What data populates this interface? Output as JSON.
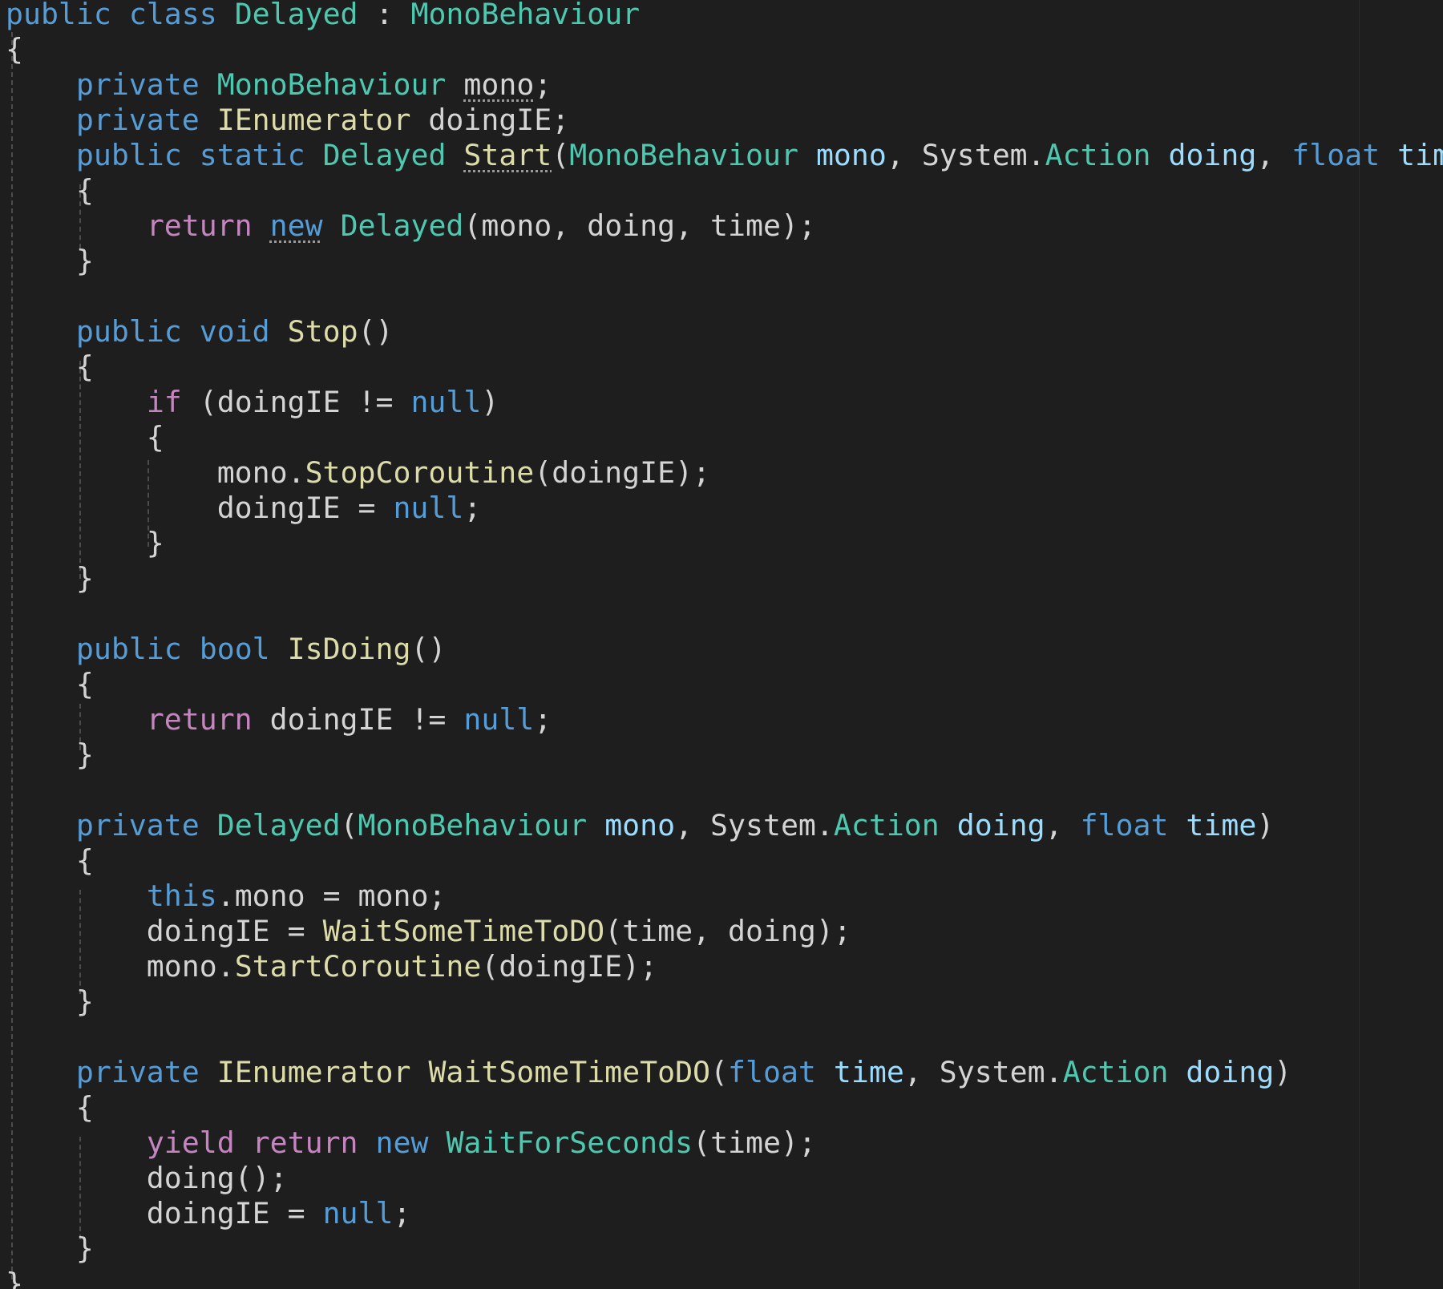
{
  "editor": {
    "theme_background": "#1e1e1e",
    "colors": {
      "keyword": "#569cd6",
      "control_keyword": "#c586c0",
      "type": "#4ec9b0",
      "function": "#dcdcaa",
      "parameter": "#9cdcfe",
      "text": "#d4d4d4"
    },
    "lines": [
      [
        {
          "t": "public",
          "c": "k-blue"
        },
        {
          "t": " ",
          "c": "k-plain"
        },
        {
          "t": "class",
          "c": "k-blue"
        },
        {
          "t": " ",
          "c": "k-plain"
        },
        {
          "t": "Delayed",
          "c": "k-type"
        },
        {
          "t": " : ",
          "c": "k-plain"
        },
        {
          "t": "MonoBehaviour",
          "c": "k-type"
        }
      ],
      [
        {
          "t": "{",
          "c": "k-plain"
        }
      ],
      [
        {
          "t": "    ",
          "c": "k-plain"
        },
        {
          "t": "private",
          "c": "k-blue"
        },
        {
          "t": " ",
          "c": "k-plain"
        },
        {
          "t": "MonoBehaviour",
          "c": "k-type"
        },
        {
          "t": " ",
          "c": "k-plain"
        },
        {
          "t": "mono",
          "c": "k-plain",
          "u": true
        },
        {
          "t": ";",
          "c": "k-plain"
        }
      ],
      [
        {
          "t": "    ",
          "c": "k-plain"
        },
        {
          "t": "private",
          "c": "k-blue"
        },
        {
          "t": " ",
          "c": "k-plain"
        },
        {
          "t": "IEnumerator",
          "c": "k-fn"
        },
        {
          "t": " doingIE;",
          "c": "k-plain"
        }
      ],
      [
        {
          "t": "    ",
          "c": "k-plain"
        },
        {
          "t": "public",
          "c": "k-blue"
        },
        {
          "t": " ",
          "c": "k-plain"
        },
        {
          "t": "static",
          "c": "k-blue"
        },
        {
          "t": " ",
          "c": "k-plain"
        },
        {
          "t": "Delayed",
          "c": "k-type"
        },
        {
          "t": " ",
          "c": "k-plain"
        },
        {
          "t": "Start",
          "c": "k-fn",
          "u": true
        },
        {
          "t": "(",
          "c": "k-plain"
        },
        {
          "t": "MonoBehaviour",
          "c": "k-type"
        },
        {
          "t": " ",
          "c": "k-plain"
        },
        {
          "t": "mono",
          "c": "k-param"
        },
        {
          "t": ", System.",
          "c": "k-plain"
        },
        {
          "t": "Action",
          "c": "k-type"
        },
        {
          "t": " ",
          "c": "k-plain"
        },
        {
          "t": "doing",
          "c": "k-param"
        },
        {
          "t": ", ",
          "c": "k-plain"
        },
        {
          "t": "float",
          "c": "k-blue"
        },
        {
          "t": " ",
          "c": "k-plain"
        },
        {
          "t": "time",
          "c": "k-param"
        },
        {
          "t": ")",
          "c": "k-plain"
        }
      ],
      [
        {
          "t": "    {",
          "c": "k-plain"
        }
      ],
      [
        {
          "t": "        ",
          "c": "k-plain"
        },
        {
          "t": "return",
          "c": "k-purple"
        },
        {
          "t": " ",
          "c": "k-plain"
        },
        {
          "t": "new",
          "c": "k-blue",
          "u": true
        },
        {
          "t": " ",
          "c": "k-plain"
        },
        {
          "t": "Delayed",
          "c": "k-type"
        },
        {
          "t": "(mono, doing, time);",
          "c": "k-plain"
        }
      ],
      [
        {
          "t": "    }",
          "c": "k-plain"
        }
      ],
      [],
      [
        {
          "t": "    ",
          "c": "k-plain"
        },
        {
          "t": "public",
          "c": "k-blue"
        },
        {
          "t": " ",
          "c": "k-plain"
        },
        {
          "t": "void",
          "c": "k-blue"
        },
        {
          "t": " ",
          "c": "k-plain"
        },
        {
          "t": "Stop",
          "c": "k-fn"
        },
        {
          "t": "()",
          "c": "k-plain"
        }
      ],
      [
        {
          "t": "    {",
          "c": "k-plain"
        }
      ],
      [
        {
          "t": "        ",
          "c": "k-plain"
        },
        {
          "t": "if",
          "c": "k-purple"
        },
        {
          "t": " (doingIE != ",
          "c": "k-plain"
        },
        {
          "t": "null",
          "c": "k-blue"
        },
        {
          "t": ")",
          "c": "k-plain"
        }
      ],
      [
        {
          "t": "        {",
          "c": "k-plain"
        }
      ],
      [
        {
          "t": "            mono.",
          "c": "k-plain"
        },
        {
          "t": "StopCoroutine",
          "c": "k-fn"
        },
        {
          "t": "(doingIE);",
          "c": "k-plain"
        }
      ],
      [
        {
          "t": "            doingIE = ",
          "c": "k-plain"
        },
        {
          "t": "null",
          "c": "k-blue"
        },
        {
          "t": ";",
          "c": "k-plain"
        }
      ],
      [
        {
          "t": "        }",
          "c": "k-plain"
        }
      ],
      [
        {
          "t": "    }",
          "c": "k-plain"
        }
      ],
      [],
      [
        {
          "t": "    ",
          "c": "k-plain"
        },
        {
          "t": "public",
          "c": "k-blue"
        },
        {
          "t": " ",
          "c": "k-plain"
        },
        {
          "t": "bool",
          "c": "k-blue"
        },
        {
          "t": " ",
          "c": "k-plain"
        },
        {
          "t": "IsDoing",
          "c": "k-fn"
        },
        {
          "t": "()",
          "c": "k-plain"
        }
      ],
      [
        {
          "t": "    {",
          "c": "k-plain"
        }
      ],
      [
        {
          "t": "        ",
          "c": "k-plain"
        },
        {
          "t": "return",
          "c": "k-purple"
        },
        {
          "t": " doingIE != ",
          "c": "k-plain"
        },
        {
          "t": "null",
          "c": "k-blue"
        },
        {
          "t": ";",
          "c": "k-plain"
        }
      ],
      [
        {
          "t": "    }",
          "c": "k-plain"
        }
      ],
      [],
      [
        {
          "t": "    ",
          "c": "k-plain"
        },
        {
          "t": "private",
          "c": "k-blue"
        },
        {
          "t": " ",
          "c": "k-plain"
        },
        {
          "t": "Delayed",
          "c": "k-type"
        },
        {
          "t": "(",
          "c": "k-plain"
        },
        {
          "t": "MonoBehaviour",
          "c": "k-type"
        },
        {
          "t": " ",
          "c": "k-plain"
        },
        {
          "t": "mono",
          "c": "k-param"
        },
        {
          "t": ", System.",
          "c": "k-plain"
        },
        {
          "t": "Action",
          "c": "k-type"
        },
        {
          "t": " ",
          "c": "k-plain"
        },
        {
          "t": "doing",
          "c": "k-param"
        },
        {
          "t": ", ",
          "c": "k-plain"
        },
        {
          "t": "float",
          "c": "k-blue"
        },
        {
          "t": " ",
          "c": "k-plain"
        },
        {
          "t": "time",
          "c": "k-param"
        },
        {
          "t": ")",
          "c": "k-plain"
        }
      ],
      [
        {
          "t": "    {",
          "c": "k-plain"
        }
      ],
      [
        {
          "t": "        ",
          "c": "k-plain"
        },
        {
          "t": "this",
          "c": "k-blue"
        },
        {
          "t": ".mono = mono;",
          "c": "k-plain"
        }
      ],
      [
        {
          "t": "        doingIE = ",
          "c": "k-plain"
        },
        {
          "t": "WaitSomeTimeToDO",
          "c": "k-fn"
        },
        {
          "t": "(time, doing);",
          "c": "k-plain"
        }
      ],
      [
        {
          "t": "        mono.",
          "c": "k-plain"
        },
        {
          "t": "StartCoroutine",
          "c": "k-fn"
        },
        {
          "t": "(doingIE);",
          "c": "k-plain"
        }
      ],
      [
        {
          "t": "    }",
          "c": "k-plain"
        }
      ],
      [],
      [
        {
          "t": "    ",
          "c": "k-plain"
        },
        {
          "t": "private",
          "c": "k-blue"
        },
        {
          "t": " ",
          "c": "k-plain"
        },
        {
          "t": "IEnumerator",
          "c": "k-fn"
        },
        {
          "t": " ",
          "c": "k-plain"
        },
        {
          "t": "WaitSomeTimeToDO",
          "c": "k-fn"
        },
        {
          "t": "(",
          "c": "k-plain"
        },
        {
          "t": "float",
          "c": "k-blue"
        },
        {
          "t": " ",
          "c": "k-plain"
        },
        {
          "t": "time",
          "c": "k-param"
        },
        {
          "t": ", System.",
          "c": "k-plain"
        },
        {
          "t": "Action",
          "c": "k-type"
        },
        {
          "t": " ",
          "c": "k-plain"
        },
        {
          "t": "doing",
          "c": "k-param"
        },
        {
          "t": ")",
          "c": "k-plain"
        }
      ],
      [
        {
          "t": "    {",
          "c": "k-plain"
        }
      ],
      [
        {
          "t": "        ",
          "c": "k-plain"
        },
        {
          "t": "yield",
          "c": "k-purple"
        },
        {
          "t": " ",
          "c": "k-plain"
        },
        {
          "t": "return",
          "c": "k-purple"
        },
        {
          "t": " ",
          "c": "k-plain"
        },
        {
          "t": "new",
          "c": "k-blue"
        },
        {
          "t": " ",
          "c": "k-plain"
        },
        {
          "t": "WaitForSeconds",
          "c": "k-type"
        },
        {
          "t": "(time);",
          "c": "k-plain"
        }
      ],
      [
        {
          "t": "        doing();",
          "c": "k-plain"
        }
      ],
      [
        {
          "t": "        doingIE = ",
          "c": "k-plain"
        },
        {
          "t": "null",
          "c": "k-blue"
        },
        {
          "t": ";",
          "c": "k-plain"
        }
      ],
      [
        {
          "t": "    }",
          "c": "k-plain"
        }
      ],
      [
        {
          "t": "}",
          "c": "k-plain"
        }
      ]
    ]
  }
}
